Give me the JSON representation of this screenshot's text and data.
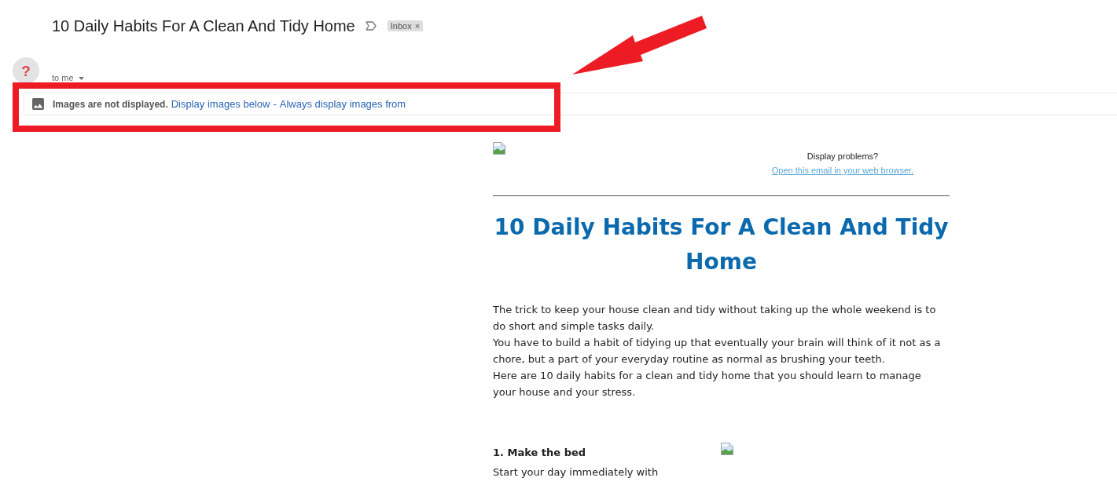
{
  "email": {
    "subject": "10 Daily Habits For A Clean And Tidy Home",
    "labels": [
      {
        "text": "Inbox",
        "remove": "×"
      }
    ]
  },
  "sender": {
    "avatar": "?",
    "recipient": "to me"
  },
  "images_notice": {
    "message": "Images are not displayed.",
    "links": [
      "Display images below",
      "Always display images from"
    ],
    "separator": "-"
  },
  "body": {
    "preheader": {
      "prompt": "Display problems?",
      "link": "Open this email in your web browser."
    },
    "heading": "10 Daily Habits For A Clean And Tidy Home",
    "paragraphs": [
      "The trick to keep your house clean and tidy without taking up the whole weekend is to do short and simple tasks daily.",
      "You have to build a habit of tidying up that eventually your brain will think of it not as a chore, but a part of your everyday routine as normal as brushing your teeth.",
      "Here are 10 daily habits for a clean and tidy home that you should learn to manage your house and your stress."
    ],
    "sections": [
      {
        "title": "1. Make the bed",
        "text": "Start your day immediately with"
      }
    ]
  },
  "annotations": {
    "highlight_rectangle": true,
    "arrow": true
  }
}
